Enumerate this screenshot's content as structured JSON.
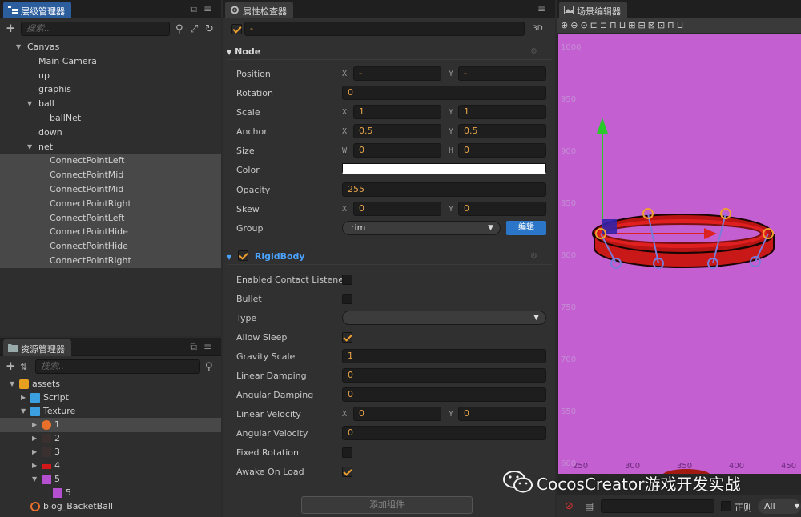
{
  "hierarchy": {
    "tab_label": "层级管理器",
    "search_placeholder": "搜索..",
    "nodes": [
      {
        "label": "Canvas",
        "depth": 0,
        "arrow": "▼"
      },
      {
        "label": "Main Camera",
        "depth": 1,
        "arrow": ""
      },
      {
        "label": "up",
        "depth": 1,
        "arrow": ""
      },
      {
        "label": "graphis",
        "depth": 1,
        "arrow": ""
      },
      {
        "label": "ball",
        "depth": 1,
        "arrow": "▼"
      },
      {
        "label": "ballNet",
        "depth": 2,
        "arrow": ""
      },
      {
        "label": "down",
        "depth": 1,
        "arrow": ""
      },
      {
        "label": "net",
        "depth": 1,
        "arrow": "▼"
      },
      {
        "label": "ConnectPointLeft",
        "depth": 2,
        "arrow": "",
        "selected": true
      },
      {
        "label": "ConnectPointMid",
        "depth": 2,
        "arrow": "",
        "selected": true
      },
      {
        "label": "ConnectPointMid",
        "depth": 2,
        "arrow": "",
        "selected": true
      },
      {
        "label": "ConnectPointRight",
        "depth": 2,
        "arrow": "",
        "selected": true
      },
      {
        "label": "ConnectPointLeft",
        "depth": 2,
        "arrow": "",
        "selected": true
      },
      {
        "label": "ConnectPointHide",
        "depth": 2,
        "arrow": "",
        "selected": true
      },
      {
        "label": "ConnectPointHide",
        "depth": 2,
        "arrow": "",
        "selected": true
      },
      {
        "label": "ConnectPointRight",
        "depth": 2,
        "arrow": "",
        "selected": true
      }
    ]
  },
  "assets": {
    "tab_label": "资源管理器",
    "search_placeholder": "搜索..",
    "items": [
      {
        "label": "assets",
        "icon": "db-icon",
        "arrow": "▼",
        "depth": 0
      },
      {
        "label": "Script",
        "icon": "folder-icon",
        "arrow": "▶",
        "depth": 1
      },
      {
        "label": "Texture",
        "icon": "folder-open-icon",
        "arrow": "▼",
        "depth": 1
      },
      {
        "label": "1",
        "icon": "ball-texture-icon",
        "arrow": "▶",
        "depth": 2,
        "selected": true
      },
      {
        "label": "2",
        "icon": "dark-texture-icon",
        "arrow": "▶",
        "depth": 2
      },
      {
        "label": "3",
        "icon": "dark-texture-icon",
        "arrow": "▶",
        "depth": 2
      },
      {
        "label": "4",
        "icon": "red-texture-icon",
        "arrow": "▶",
        "depth": 2
      },
      {
        "label": "5",
        "icon": "purple-texture-icon",
        "arrow": "▼",
        "depth": 2
      },
      {
        "label": "5",
        "icon": "purple-texture-icon",
        "arrow": "",
        "depth": 3
      },
      {
        "label": "blog_BacketBall",
        "icon": "fire-icon",
        "arrow": "",
        "depth": 1
      }
    ]
  },
  "inspector": {
    "tab_label": "属性检查器",
    "node_name": "-",
    "mode_3d": "3D",
    "node_section": "Node",
    "props": {
      "position": {
        "label": "Position",
        "x": "-",
        "y": "-"
      },
      "rotation": {
        "label": "Rotation",
        "value": "0"
      },
      "scale": {
        "label": "Scale",
        "x": "1",
        "y": "1"
      },
      "anchor": {
        "label": "Anchor",
        "x": "0.5",
        "y": "0.5"
      },
      "size": {
        "label": "Size",
        "w": "0",
        "h": "0"
      },
      "color": {
        "label": "Color",
        "value": "#ffffff"
      },
      "opacity": {
        "label": "Opacity",
        "value": "255"
      },
      "skew": {
        "label": "Skew",
        "x": "0",
        "y": "0"
      },
      "group": {
        "label": "Group",
        "value": "rim",
        "edit": "编辑"
      }
    },
    "axis_labels": {
      "x": "X",
      "y": "Y",
      "w": "W",
      "h": "H"
    },
    "rigidbody_section": "RigidBody",
    "rigidbody": {
      "enabled_contact_listener": {
        "label": "Enabled Contact Listener",
        "checked": false
      },
      "bullet": {
        "label": "Bullet",
        "checked": false
      },
      "type": {
        "label": "Type",
        "value": ""
      },
      "allow_sleep": {
        "label": "Allow Sleep",
        "checked": true
      },
      "gravity_scale": {
        "label": "Gravity Scale",
        "value": "1"
      },
      "linear_damping": {
        "label": "Linear Damping",
        "value": "0"
      },
      "angular_damping": {
        "label": "Angular Damping",
        "value": "0"
      },
      "linear_velocity": {
        "label": "Linear Velocity",
        "x": "0",
        "y": "0"
      },
      "angular_velocity": {
        "label": "Angular Velocity",
        "value": "0"
      },
      "fixed_rotation": {
        "label": "Fixed Rotation",
        "checked": false
      },
      "awake_on_load": {
        "label": "Awake On Load",
        "checked": true
      }
    },
    "add_component": "添加组件"
  },
  "scene": {
    "tab_label": "场景编辑器",
    "bg_color": "#c35fd1",
    "y_ticks": [
      "1000",
      "950",
      "900",
      "850",
      "800",
      "750",
      "700",
      "650",
      "600"
    ],
    "x_ticks": [
      "250",
      "300",
      "350",
      "400",
      "450"
    ],
    "console_filter": "All",
    "console_regex": "正则"
  },
  "watermark": "CocosCreator游戏开发实战"
}
